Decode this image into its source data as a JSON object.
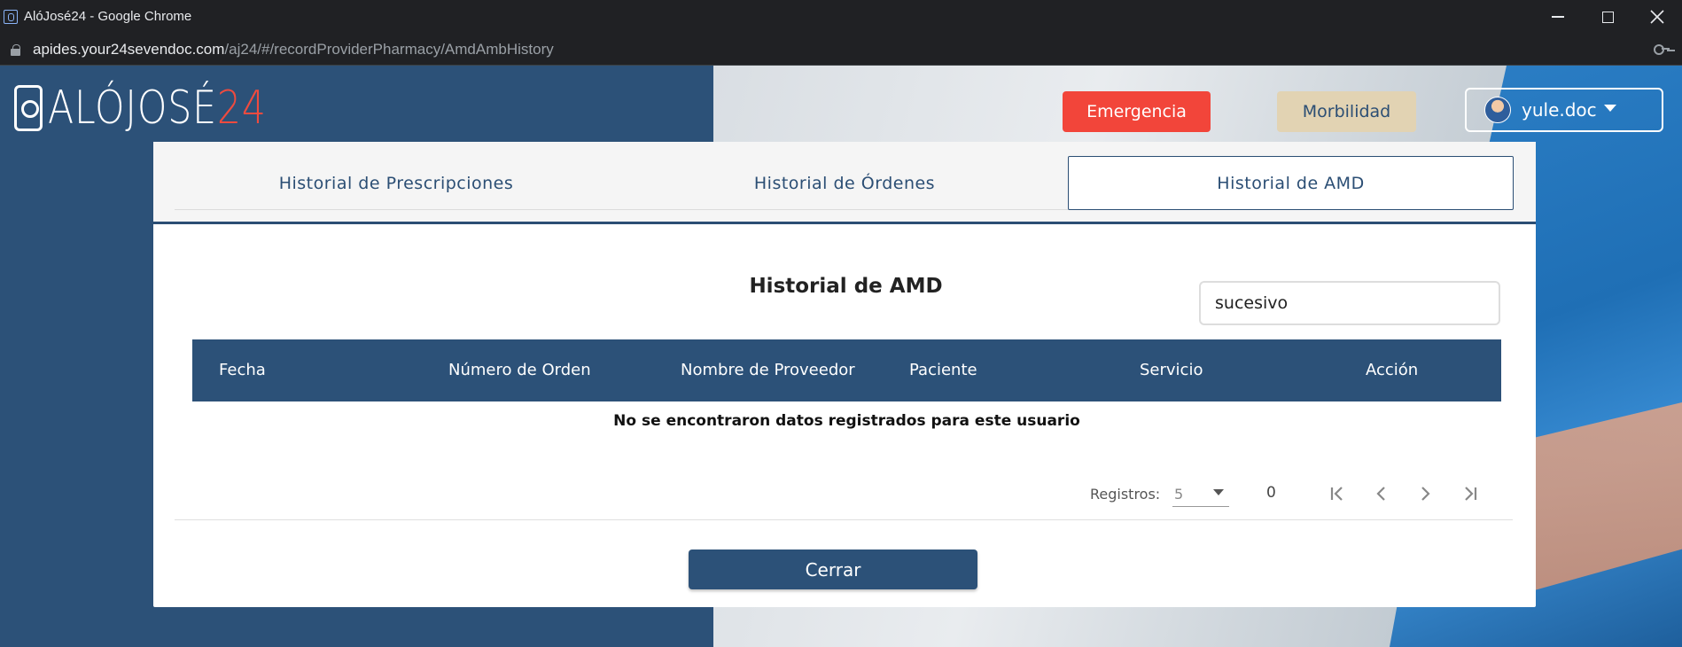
{
  "browser": {
    "window_title": "AlóJosé24 - Google Chrome",
    "url_host": "apides.your24sevendoc.com",
    "url_path": "/aj24/#/recordProviderPharmacy/AmdAmbHistory"
  },
  "header": {
    "logo_text": "ALÓJOSÉ",
    "logo_number": "24",
    "emergency_label": "Emergencia",
    "morbidity_label": "Morbilidad",
    "username": "yule.doc"
  },
  "tabs": [
    {
      "label": "Historial de Prescripciones",
      "active": false
    },
    {
      "label": "Historial de Órdenes",
      "active": false
    },
    {
      "label": "Historial de AMD",
      "active": true
    }
  ],
  "main": {
    "title": "Historial de AMD",
    "search_value": "sucesivo",
    "columns": [
      "Fecha",
      "Número de Orden",
      "Nombre de Proveedor",
      "Paciente",
      "Servicio",
      "Acción"
    ],
    "empty_message": "No se encontraron datos registrados para este usuario"
  },
  "pagination": {
    "records_label": "Registros:",
    "page_size": "5",
    "range_text": "0"
  },
  "footer": {
    "close_label": "Cerrar"
  },
  "colors": {
    "primary": "#2c5178",
    "emergency": "#f2453a",
    "morbidity": "#e2d3b3"
  }
}
